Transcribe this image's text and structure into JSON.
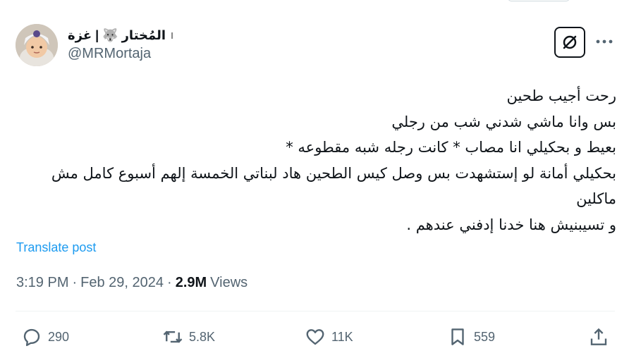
{
  "user": {
    "display_name": "المُختار 🐺 | غزة",
    "name_mark": "ا",
    "handle": "@MRMortaja"
  },
  "tweet": {
    "lines": [
      "رحت أجيب طحين",
      "بس وانا ماشي شدني شب من رجلي",
      "بعيط و بحكيلي انا مصاب * كانت رجله شبه مقطوعه *",
      "بحكيلي أمانة لو إستشهدت بس وصل كيس الطحين هاد لبناتي الخمسة إلهم أسبوع كامل مش ماكلين",
      "و تسيبنيش هنا خدنا إدفني عندهم ."
    ],
    "translate_label": "Translate post"
  },
  "meta": {
    "time": "3:19 PM",
    "date": "Feb 29, 2024",
    "views_count": "2.9M",
    "views_label": "Views",
    "separator": "·"
  },
  "actions": {
    "replies": "290",
    "reposts": "5.8K",
    "likes": "11K",
    "bookmarks": "559"
  },
  "icons": {
    "grok": "grok-icon",
    "more": "more-icon",
    "reply": "reply-icon",
    "repost": "repost-icon",
    "like": "heart-icon",
    "bookmark": "bookmark-icon",
    "share": "share-icon"
  },
  "colors": {
    "link": "#1d9bf0",
    "secondary_text": "#536471",
    "primary_text": "#0f1419",
    "divider": "#eff3f4"
  }
}
